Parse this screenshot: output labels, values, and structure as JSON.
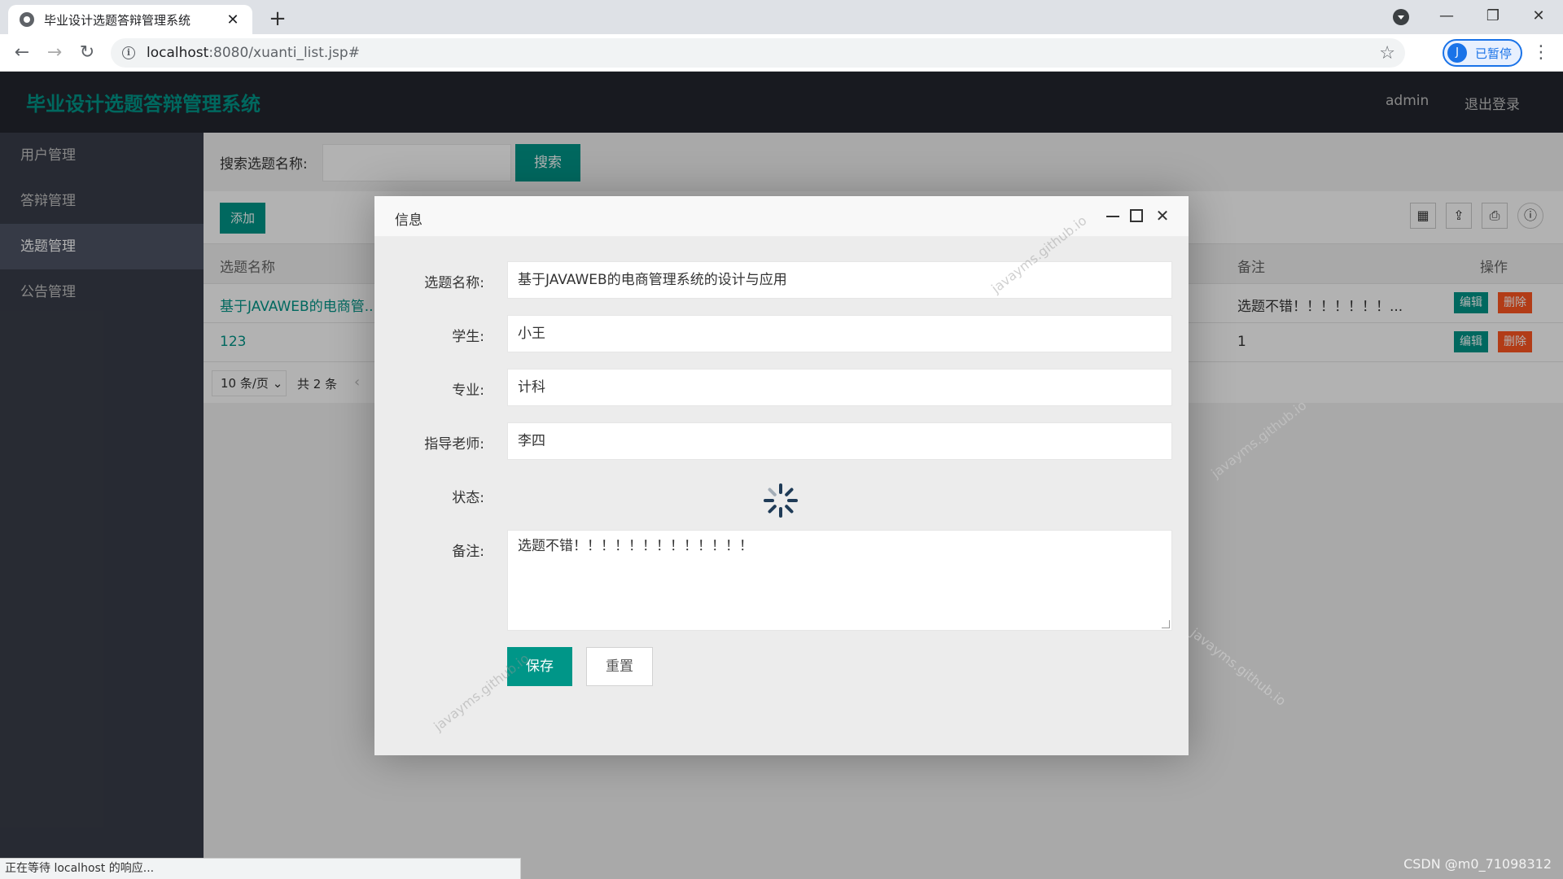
{
  "browser": {
    "tab_title": "毕业设计选题答辩管理系统",
    "tab_close": "✕",
    "new_tab": "+",
    "url_host": "localhost",
    "url_rest": ":8080/xuanti_list.jsp#",
    "profile_initial": "J",
    "profile_status": "已暂停",
    "icons": [
      "back-icon",
      "forward-icon",
      "reload-icon",
      "info-icon",
      "star-icon",
      "menu-icon"
    ]
  },
  "app": {
    "title": "毕业设计选题答辩管理系统",
    "user": "admin",
    "logout": "退出登录",
    "accent_color": "#009688",
    "danger_color": "#ff5722"
  },
  "sidebar": {
    "items": [
      {
        "label": "用户管理"
      },
      {
        "label": "答辩管理"
      },
      {
        "label": "选题管理",
        "active": true
      },
      {
        "label": "公告管理"
      }
    ]
  },
  "search": {
    "label": "搜索选题名称:",
    "placeholder": "",
    "button": "搜索"
  },
  "table": {
    "add_button": "添加",
    "columns": {
      "name": "选题名称",
      "remark": "备注",
      "action": "操作"
    },
    "rows": [
      {
        "name": "基于JAVAWEB的电商管...",
        "remark": "选题不错！！！！！！！...",
        "edit": "编辑",
        "delete": "删除"
      },
      {
        "name": "123",
        "remark": "1",
        "edit": "编辑",
        "delete": "删除"
      }
    ],
    "pager": {
      "page_size": "10 条/页",
      "total": "共 2 条"
    }
  },
  "modal": {
    "title": "信息",
    "fields": {
      "topic_label": "选题名称:",
      "topic_value": "基于JAVAWEB的电商管理系统的设计与应用",
      "student_label": "学生:",
      "student_value": "小王",
      "major_label": "专业:",
      "major_value": "计科",
      "teacher_label": "指导老师:",
      "teacher_value": "李四",
      "status_label": "状态:",
      "remark_label": "备注:",
      "remark_value": "选题不错！！！！！！！！！！！！！"
    },
    "save_button": "保存",
    "reset_button": "重置",
    "watermark": "javayms.github.io"
  },
  "status_bar": "正在等待 localhost 的响应...",
  "corner_mark": "CSDN @m0_71098312"
}
